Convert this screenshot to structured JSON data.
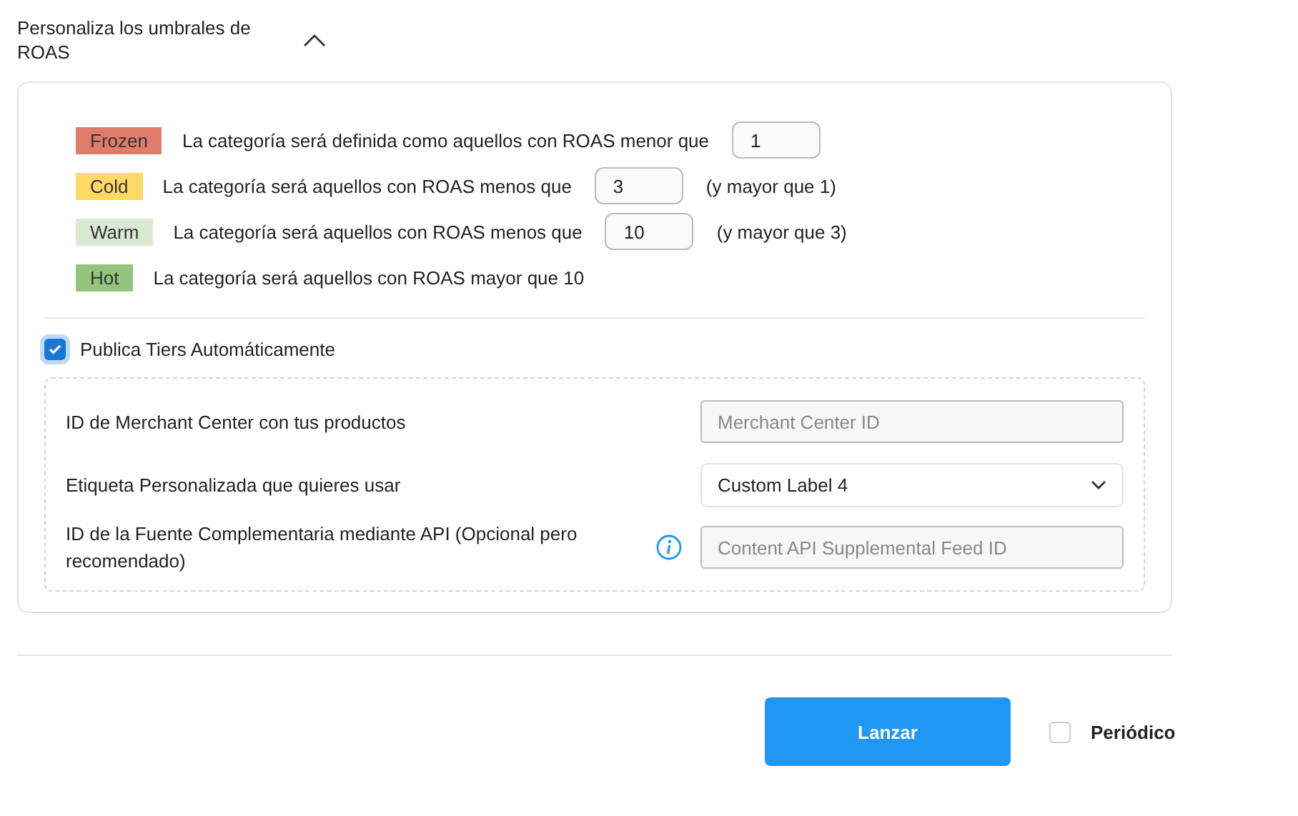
{
  "section": {
    "title": "Personaliza los umbrales de ROAS",
    "expanded": true
  },
  "tiers": [
    {
      "tag": "Frozen",
      "color": "#e07c6a",
      "text": "La categoría será definida como aquellos con ROAS menor que",
      "value": "1"
    },
    {
      "tag": "Cold",
      "color": "#fed966",
      "text": "La categoría será aquellos con ROAS menos que",
      "value": "3",
      "suffix": "(y mayor que 1)"
    },
    {
      "tag": "Warm",
      "color": "#d9ead3",
      "text": "La categoría será aquellos con ROAS menos que",
      "value": "10",
      "suffix": "(y mayor que 3)"
    },
    {
      "tag": "Hot",
      "color": "#93c47d",
      "text": "La categoría será aquellos con ROAS mayor que 10"
    }
  ],
  "publish": {
    "label": "Publica Tiers Automáticamente",
    "checked": true
  },
  "fields": [
    {
      "kind": "input",
      "label": "ID de Merchant Center con tus productos",
      "placeholder": "Merchant Center ID"
    },
    {
      "kind": "select",
      "label": "Etiqueta Personalizada que quieres usar",
      "value": "Custom Label 4"
    },
    {
      "kind": "input",
      "label": "ID de la Fuente Complementaria mediante API (Opcional pero recomendado)",
      "info": true,
      "placeholder": "Content API Supplemental Feed ID"
    }
  ],
  "launch": "Lanzar",
  "periodic": {
    "label": "Periódico",
    "checked": false
  }
}
